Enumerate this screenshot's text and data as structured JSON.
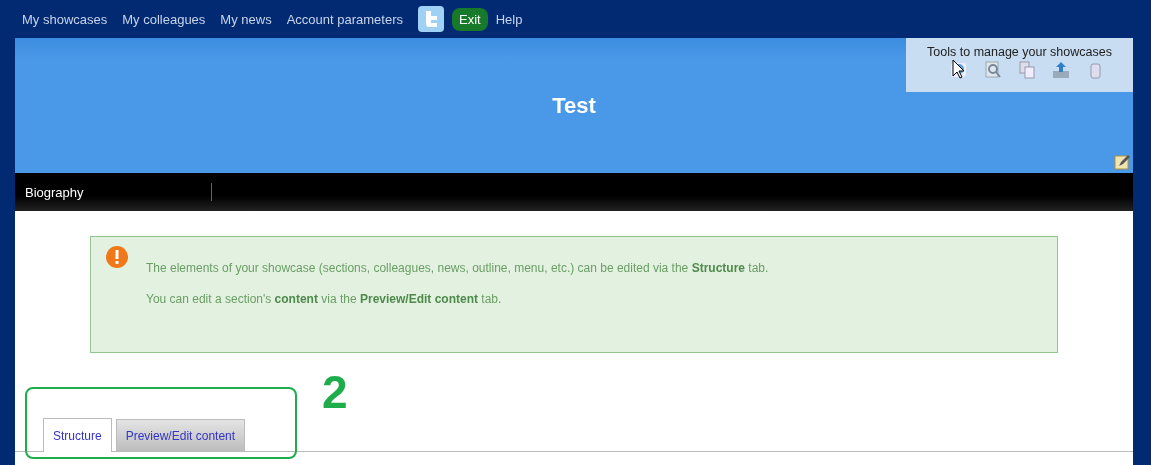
{
  "top_nav": {
    "links": [
      "My showcases",
      "My colleagues",
      "My news",
      "Account parameters"
    ],
    "exit_button": "Exit",
    "help_link": "Help"
  },
  "banner": {
    "title": "Test",
    "tools_panel": {
      "title": "Tools to manage your showcases"
    }
  },
  "section_nav": {
    "items": [
      {
        "label": "Biography",
        "selected": false
      }
    ]
  },
  "notice": {
    "lines": [
      "The elements of your showcase (sections, colleagues, news, outline, menu, etc.) can be edited via the **Structure** tab.",
      "You can edit a section's **content** via the **Preview/Edit content** tab."
    ]
  },
  "tabs": [
    {
      "label": "Structure",
      "selected": true
    },
    {
      "label": "Preview/Edit content",
      "selected": false
    }
  ],
  "annotation": {
    "number": "2"
  }
}
